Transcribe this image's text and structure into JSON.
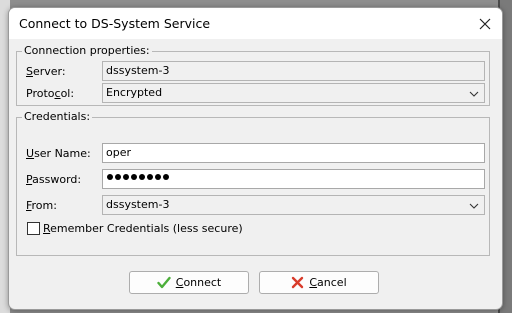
{
  "dialog": {
    "title": "Connect to DS-System Service"
  },
  "connection": {
    "group_label": "Connection properties:",
    "server_label_u": "S",
    "server_label_rest": "erver:",
    "server_value": "dssystem-3",
    "protocol_label_pre": "Proto",
    "protocol_label_u": "c",
    "protocol_label_rest": "ol:",
    "protocol_value": "Encrypted"
  },
  "credentials": {
    "group_label": "Credentials:",
    "username_label_u": "U",
    "username_label_rest": "ser Name:",
    "username_value": "oper",
    "password_label_u": "P",
    "password_label_rest": "assword:",
    "password_length": 8,
    "from_label_u": "F",
    "from_label_rest": "rom:",
    "from_value": "dssystem-3",
    "remember_label_u": "R",
    "remember_label_rest": "emember Credentials  (less secure)",
    "remember_checked": false
  },
  "buttons": {
    "connect_label_u": "C",
    "connect_label_rest": "onnect",
    "cancel_label_u": "C",
    "cancel_label_rest": "ancel"
  },
  "icons": {
    "close": "close-icon",
    "checkmark": "checkmark-icon",
    "cross": "cross-icon",
    "chevron": "chevron-down-icon"
  },
  "colors": {
    "check_green": "#4caf3a",
    "cross_red": "#d83b2a"
  }
}
